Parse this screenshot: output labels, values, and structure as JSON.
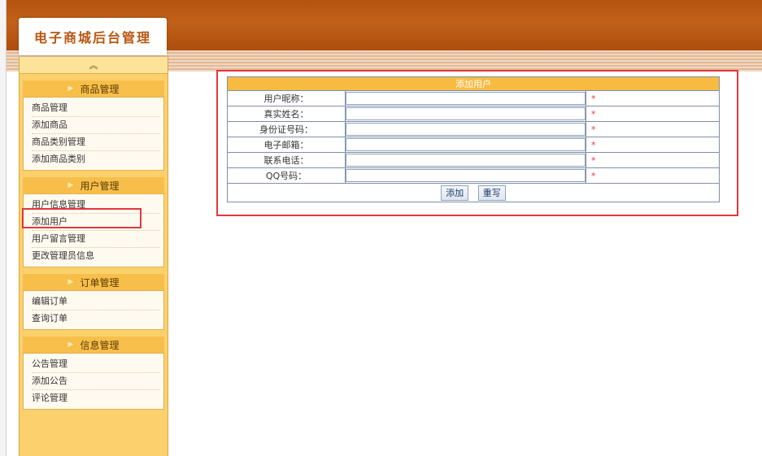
{
  "app": {
    "title": "电子商城后台管理"
  },
  "sidebar": {
    "collapse_icon": "double-chevron-up-icon",
    "groups": [
      {
        "title": "商品管理",
        "items": [
          "商品管理",
          "添加商品",
          "商品类别管理",
          "添加商品类别"
        ]
      },
      {
        "title": "用户管理",
        "items": [
          "用户信息管理",
          "添加用户",
          "用户留言管理",
          "更改管理员信息"
        ]
      },
      {
        "title": "订单管理",
        "items": [
          "编辑订单",
          "查询订单"
        ]
      },
      {
        "title": "信息管理",
        "items": [
          "公告管理",
          "添加公告",
          "评论管理"
        ]
      }
    ]
  },
  "form": {
    "title": "添加用户",
    "fields": [
      {
        "label": "用户昵称：",
        "value": "",
        "required": "*"
      },
      {
        "label": "真实姓名：",
        "value": "",
        "required": "*"
      },
      {
        "label": "身份证号码：",
        "value": "",
        "required": "*"
      },
      {
        "label": "电子邮箱：",
        "value": "",
        "required": "*"
      },
      {
        "label": "联系电话：",
        "value": "",
        "required": "*"
      },
      {
        "label": "QQ号码：",
        "value": "",
        "required": "*"
      }
    ],
    "submit_label": "添加",
    "reset_label": "重写"
  },
  "colors": {
    "header": "#b5530e",
    "sidebar": "#fcd16d",
    "group_header": "#f7bf4a",
    "form_title": "#f8bb42",
    "highlight": "#e0393e"
  }
}
